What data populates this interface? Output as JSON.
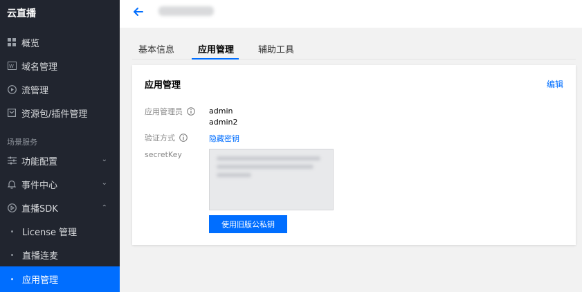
{
  "sidebar": {
    "brand": "云直播",
    "items": [
      {
        "label": "概览",
        "icon": "grid-icon"
      },
      {
        "label": "域名管理",
        "icon": "domain-icon"
      },
      {
        "label": "流管理",
        "icon": "play-circle-icon"
      },
      {
        "label": "资源包/插件管理",
        "icon": "package-icon"
      }
    ],
    "section_label": "场景服务",
    "scene_items": [
      {
        "label": "功能配置",
        "icon": "sliders-icon",
        "expanded": false
      },
      {
        "label": "事件中心",
        "icon": "bell-icon",
        "expanded": false
      },
      {
        "label": "直播SDK",
        "icon": "play-square-icon",
        "expanded": true
      }
    ],
    "sdk_subitems": [
      {
        "label": "License 管理",
        "active": false
      },
      {
        "label": "直播连麦",
        "active": false
      },
      {
        "label": "应用管理",
        "active": true
      }
    ]
  },
  "header": {
    "back_icon": "arrow-left-icon"
  },
  "tabs": [
    {
      "label": "基本信息",
      "active": false
    },
    {
      "label": "应用管理",
      "active": true
    },
    {
      "label": "辅助工具",
      "active": false
    }
  ],
  "card": {
    "title": "应用管理",
    "edit_label": "编辑",
    "admins_label": "应用管理员",
    "admins": [
      "admin",
      "admin2"
    ],
    "auth_label": "验证方式",
    "auth_value": "隐藏密钥",
    "secret_label": "secretKey",
    "button_label": "使用旧版公私钥"
  },
  "colors": {
    "sidebar_bg": "#21252f",
    "accent": "#006eff",
    "page_bg": "#f2f2f2"
  }
}
